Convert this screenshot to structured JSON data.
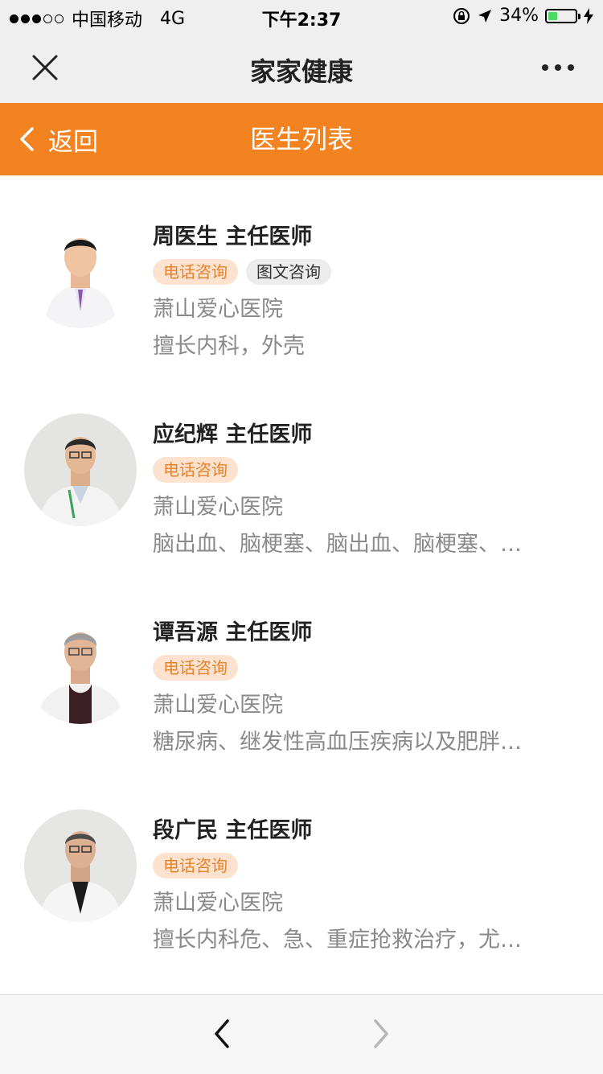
{
  "status_bar": {
    "carrier": "中国移动",
    "network": "4G",
    "time": "下午2:37",
    "battery_percent_label": "34%",
    "battery_level": 0.34,
    "signal_strength": 3,
    "signal_max": 5,
    "icons": [
      "orientation-lock-icon",
      "location-arrow-icon",
      "battery-icon",
      "charging-bolt-icon"
    ]
  },
  "title_bar": {
    "title": "家家健康",
    "close_icon": "close-icon",
    "more_icon": "more-dots-icon"
  },
  "nav_bar": {
    "back_label": "返回",
    "title": "医生列表",
    "background_color": "#f38220"
  },
  "doctors": [
    {
      "name_title": "周医生 主任医师",
      "tags": [
        "电话咨询",
        "图文咨询"
      ],
      "hospital": "萧山爱心医院",
      "specialty": "擅长内科，外壳"
    },
    {
      "name_title": "应纪辉 主任医师",
      "tags": [
        "电话咨询"
      ],
      "hospital": "萧山爱心医院",
      "specialty": "脑出血、脑梗塞、脑出血、脑梗塞、…"
    },
    {
      "name_title": "谭吾源 主任医师",
      "tags": [
        "电话咨询"
      ],
      "hospital": "萧山爱心医院",
      "specialty": "糖尿病、继发性高血压疾病以及肥胖…"
    },
    {
      "name_title": "段广民 主任医师",
      "tags": [
        "电话咨询"
      ],
      "hospital": "萧山爱心医院",
      "specialty": "擅长内科危、急、重症抢救治疗，尤…"
    }
  ],
  "bottom_bar": {
    "back_icon": "chevron-left-icon",
    "forward_icon": "chevron-right-icon"
  },
  "colors": {
    "accent": "#f38220",
    "tag_phone_bg": "#fde3cf",
    "tag_phone_text": "#e5822c",
    "tag_text_bg": "#ececec",
    "secondary_text": "#8a8a8a"
  }
}
